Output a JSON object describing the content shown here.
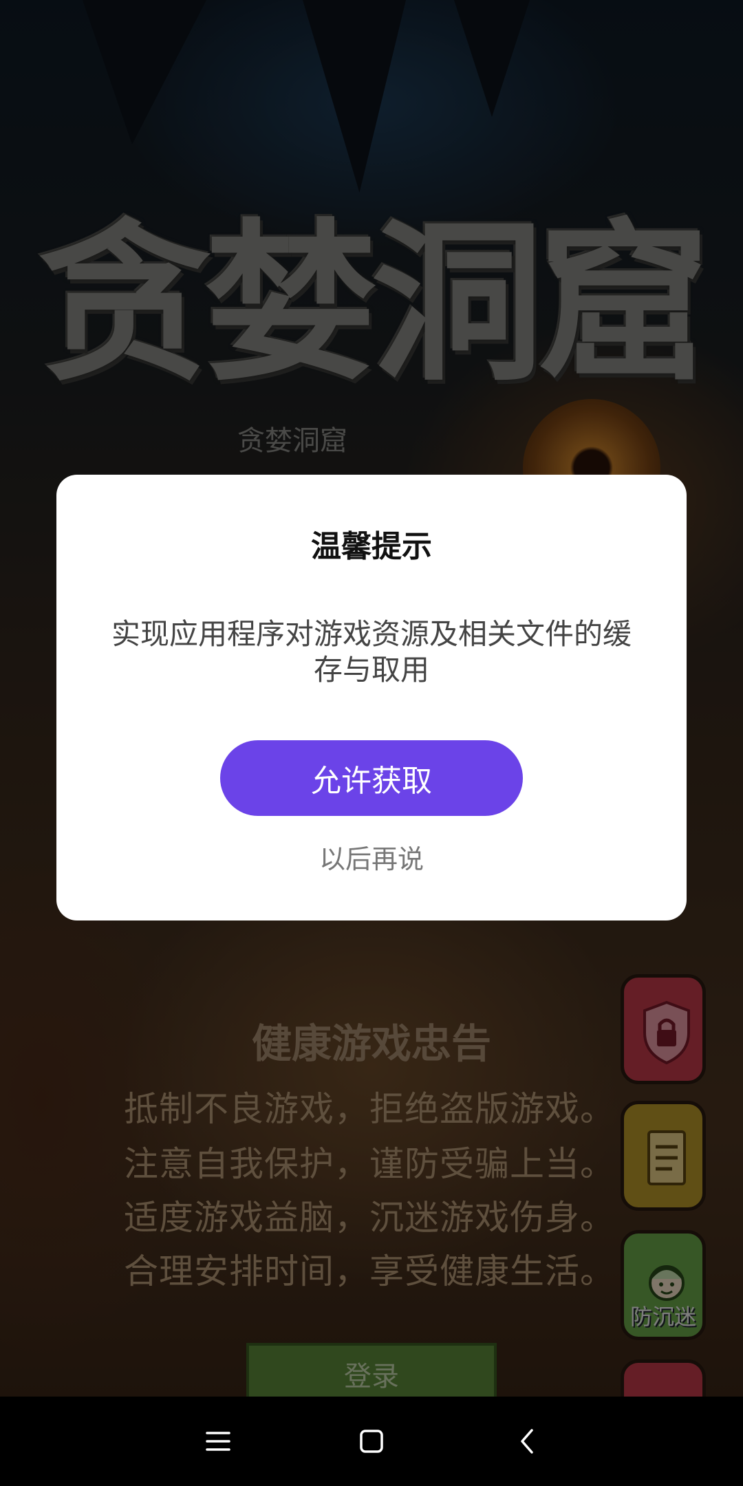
{
  "game": {
    "title_logo": "贪婪洞窟",
    "title_sub": "贪婪洞窟",
    "advisory_title": "健康游戏忠告",
    "advisory_lines": [
      "抵制不良游戏，拒绝盗版游戏。",
      "注意自我保护，谨防受骗上当。",
      "适度游戏益脑，沉迷游戏伤身。",
      "合理安排时间，享受健康生活。"
    ],
    "login_label": "登录",
    "side_buttons": [
      {
        "icon": "lock-shield-icon",
        "color": "#c23a4a"
      },
      {
        "icon": "document-icon",
        "color": "#b8972a"
      },
      {
        "icon": "child-face-icon",
        "color": "#6aa84a",
        "label": "防沉迷"
      }
    ]
  },
  "dialog": {
    "title": "温馨提示",
    "message": "实现应用程序对游戏资源及相关文件的缓存与取用",
    "allow_label": "允许获取",
    "later_label": "以后再说",
    "accent_color": "#6b43e8"
  },
  "navbar": {
    "icons": [
      "menu-icon",
      "home-icon",
      "back-icon"
    ]
  }
}
